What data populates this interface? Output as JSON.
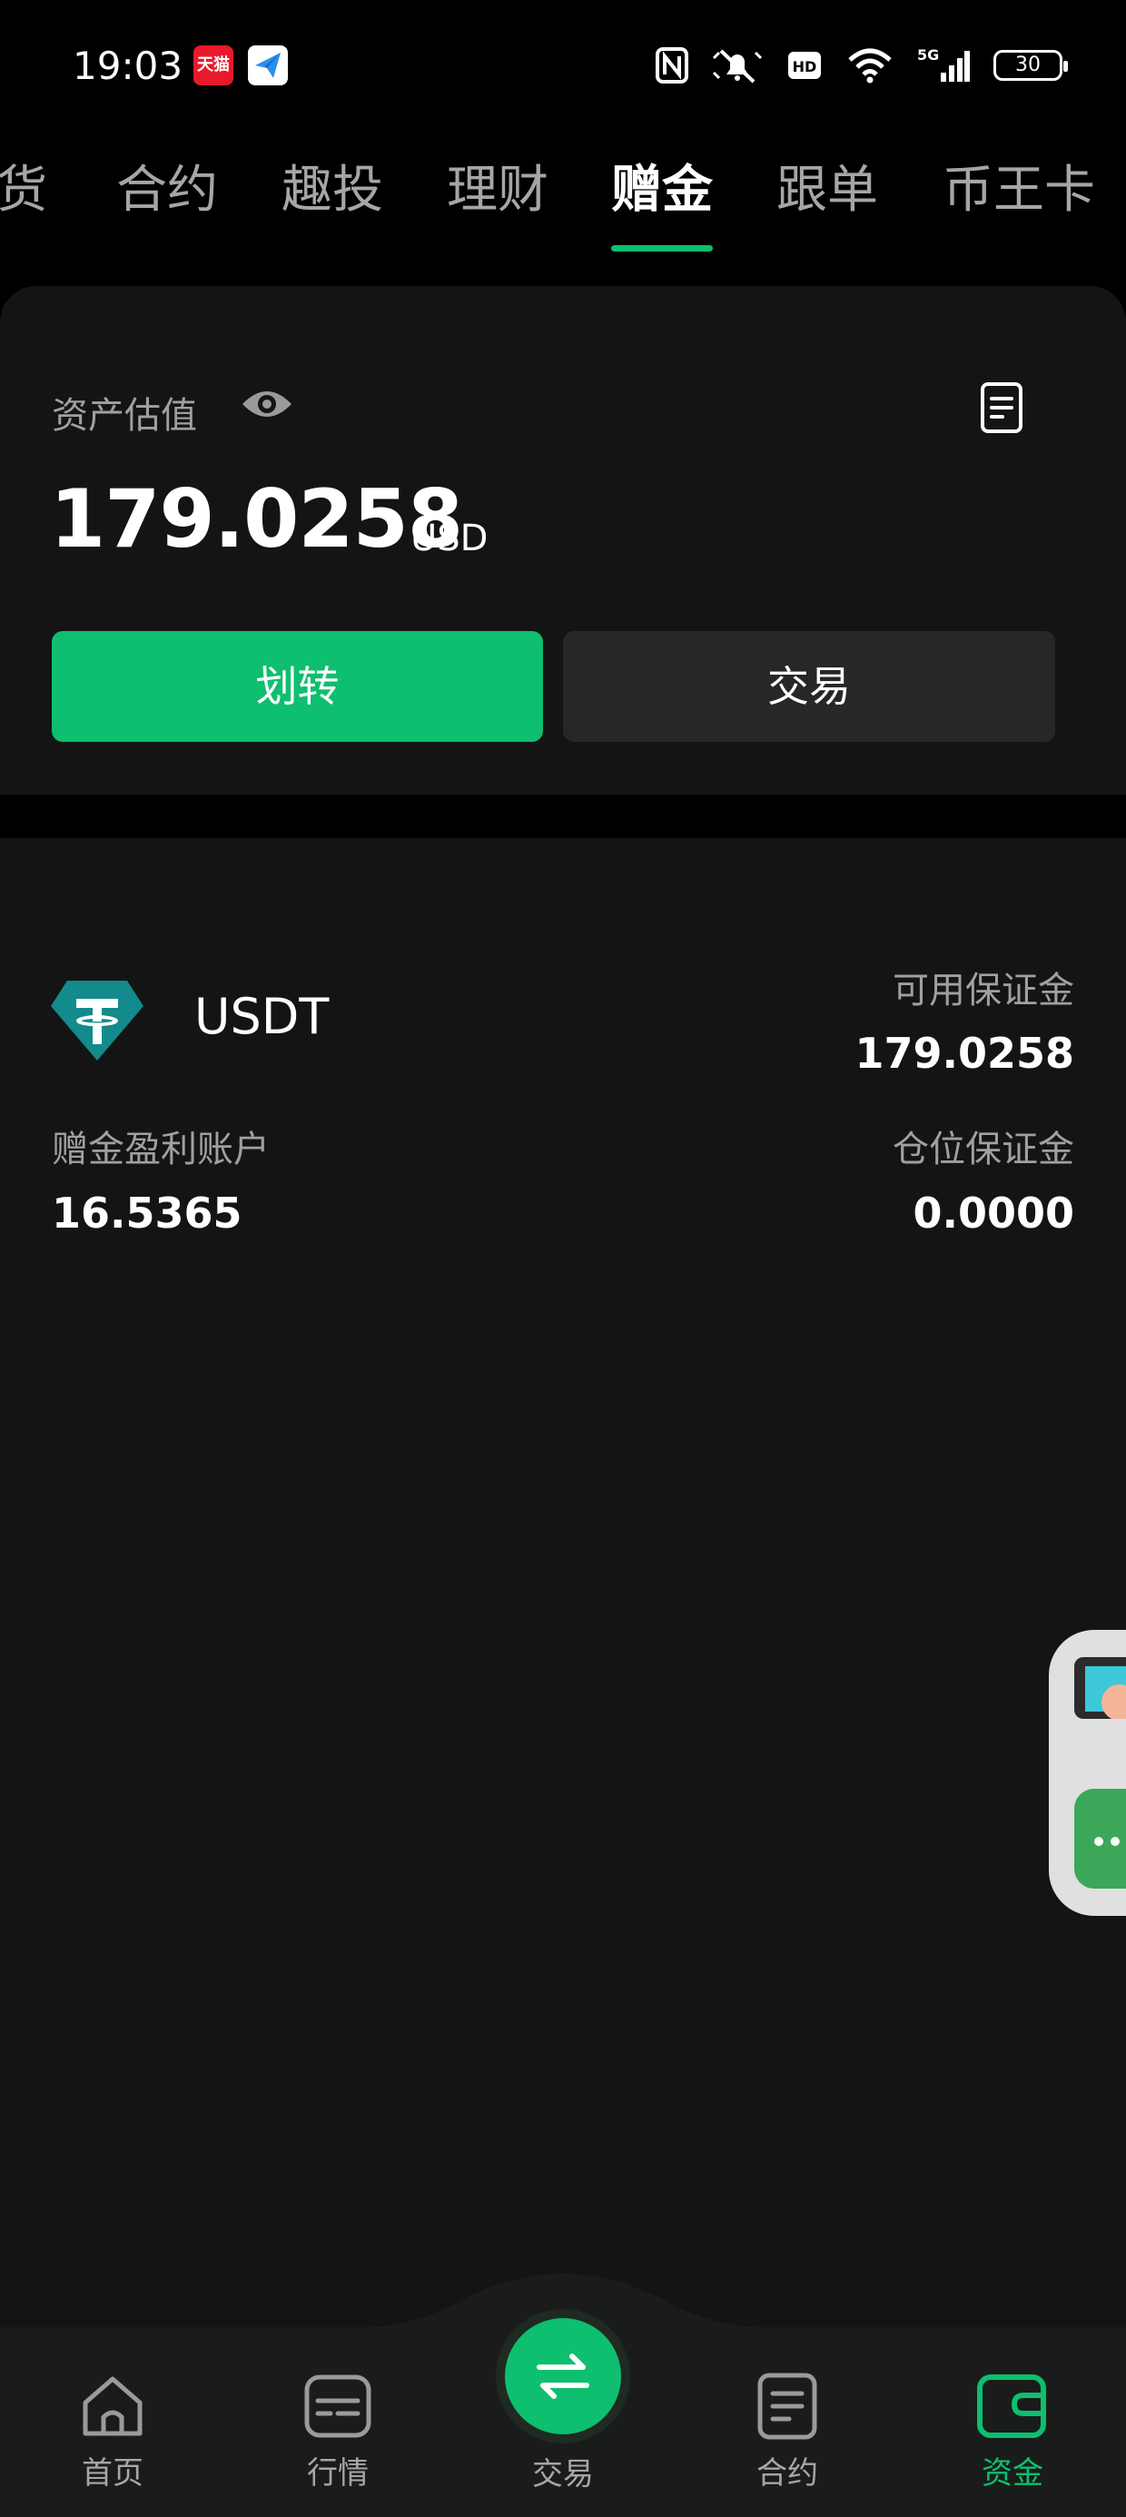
{
  "status_bar": {
    "time": "19:03",
    "tmall_badge": "天猫",
    "battery": "30",
    "icons": [
      "nfc-icon",
      "mute-icon",
      "hd-icon",
      "wifi-icon",
      "signal-5g-icon",
      "battery-icon"
    ]
  },
  "top_tabs": [
    {
      "label": "货",
      "active": false
    },
    {
      "label": "合约",
      "active": false
    },
    {
      "label": "趣投",
      "active": false
    },
    {
      "label": "理财",
      "active": false
    },
    {
      "label": "赠金",
      "active": true
    },
    {
      "label": "跟单",
      "active": false
    },
    {
      "label": "币王卡",
      "active": false
    }
  ],
  "asset": {
    "label": "资产估值",
    "amount": "179.0258",
    "unit": "USD",
    "transfer_label": "划转",
    "trade_label": "交易"
  },
  "account": {
    "coin": "USDT",
    "available_margin_label": "可用保证金",
    "available_margin_value": "179.0258",
    "bonus_profit_label": "赠金盈利账户",
    "bonus_profit_value": "16.5365",
    "position_margin_label": "仓位保证金",
    "position_margin_value": "0.0000"
  },
  "bottom_nav": {
    "home": "首页",
    "market": "行情",
    "trade": "交易",
    "contract": "合约",
    "assets": "资金"
  },
  "colors": {
    "accent": "#0dbf6e",
    "background": "#000000",
    "card": "#141414",
    "muted_text": "#a0a0a0",
    "secondary_button": "#262828",
    "usdt_icon": "#138a8c"
  }
}
